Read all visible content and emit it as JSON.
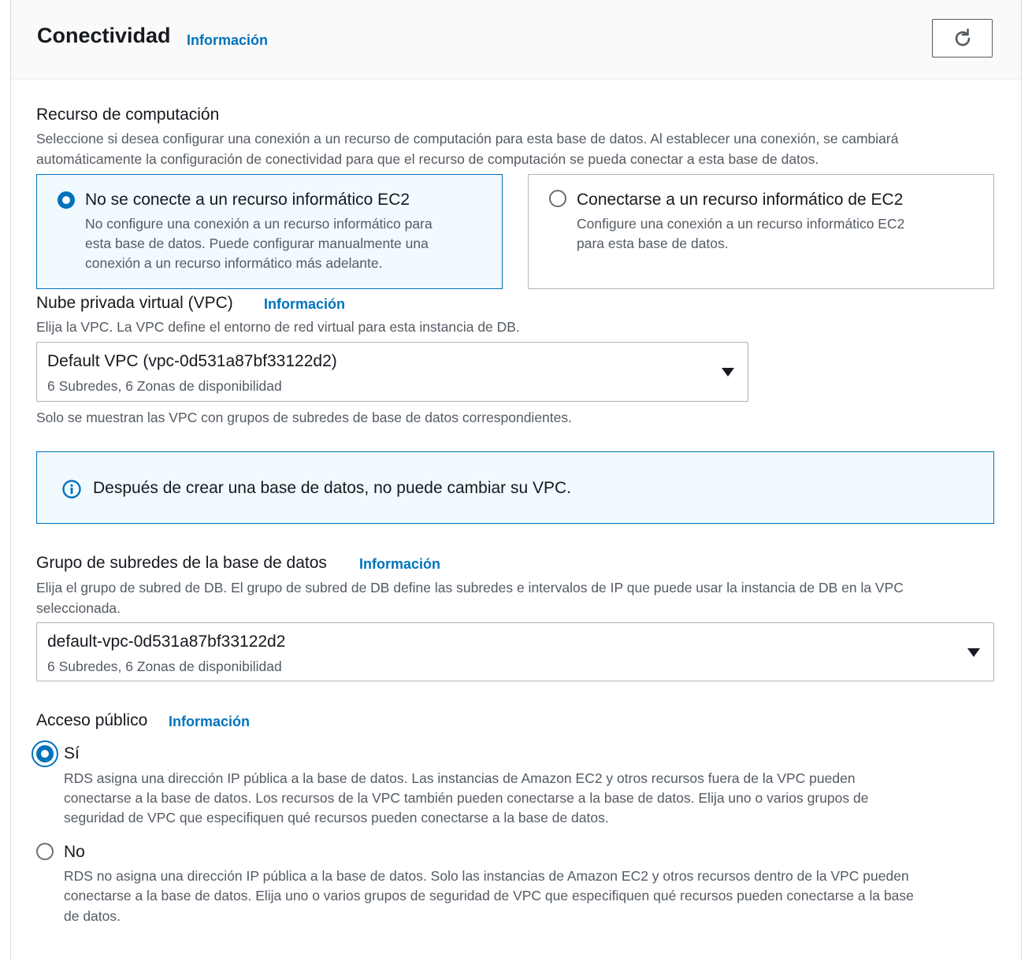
{
  "header": {
    "title": "Conectividad",
    "info": "Información"
  },
  "compute": {
    "label": "Recurso de computación",
    "description_line1": "Seleccione si desea configurar una conexión a un recurso de computación para esta base de datos. Al establecer una conexión, se cambiará",
    "description_line2": "automáticamente la configuración de conectividad para que el recurso de computación se pueda conectar a esta base de datos.",
    "options": [
      {
        "title": "No se conecte a un recurso informático EC2",
        "desc_line1": "No configure una conexión a un recurso informático para",
        "desc_line2": "esta base de datos. Puede configurar manualmente una",
        "desc_line3": "conexión a un recurso informático más adelante.",
        "selected": true
      },
      {
        "title": "Conectarse a un recurso informático de EC2",
        "desc_line1": "Configure una conexión a un recurso informático EC2",
        "desc_line2": "para esta base de datos.",
        "selected": false
      }
    ]
  },
  "vpc": {
    "label": "Nube privada virtual (VPC)",
    "info": "Información",
    "description": "Elija la VPC. La VPC define el entorno de red virtual para esta instancia de DB.",
    "value": "Default VPC (vpc-0d531a87bf33122d2)",
    "sub": "6 Subredes, 6 Zonas de disponibilidad",
    "hint": "Solo se muestran las VPC con grupos de subredes de base de datos correspondientes."
  },
  "alert": {
    "text": "Después de crear una base de datos, no puede cambiar su VPC."
  },
  "subnet_group": {
    "label": "Grupo de subredes de la base de datos",
    "info": "Información",
    "description_line1": "Elija el grupo de subred de DB. El grupo de subred de DB define las subredes e intervalos de IP que puede usar la instancia de DB en la VPC",
    "description_line2": "seleccionada.",
    "value": "default-vpc-0d531a87bf33122d2",
    "sub": "6 Subredes, 6 Zonas de disponibilidad"
  },
  "public_access": {
    "label": "Acceso público",
    "info": "Información",
    "options": [
      {
        "title": "Sí",
        "desc_line1": "RDS asigna una dirección IP pública a la base de datos. Las instancias de Amazon EC2 y otros recursos fuera de la VPC pueden",
        "desc_line2": "conectarse a la base de datos. Los recursos de la VPC también pueden conectarse a la base de datos. Elija uno o varios grupos de",
        "desc_line3": "seguridad de VPC que especifiquen qué recursos pueden conectarse a la base de datos.",
        "selected": true
      },
      {
        "title": "No",
        "desc_line1": "RDS no asigna una dirección IP pública a la base de datos. Solo las instancias de Amazon EC2 y otros recursos dentro de la VPC pueden",
        "desc_line2": "conectarse a la base de datos. Elija uno o varios grupos de seguridad de VPC que especifiquen qué recursos pueden conectarse a la base",
        "desc_line3": "de datos.",
        "selected": false
      }
    ]
  },
  "colors": {
    "accent": "#0073bb",
    "selected_bg": "#f1faff",
    "text": "#16191f",
    "muted": "#545b64"
  },
  "icons": {
    "refresh": "refresh-icon",
    "info": "info-circle-icon",
    "caret": "caret-down-icon"
  }
}
